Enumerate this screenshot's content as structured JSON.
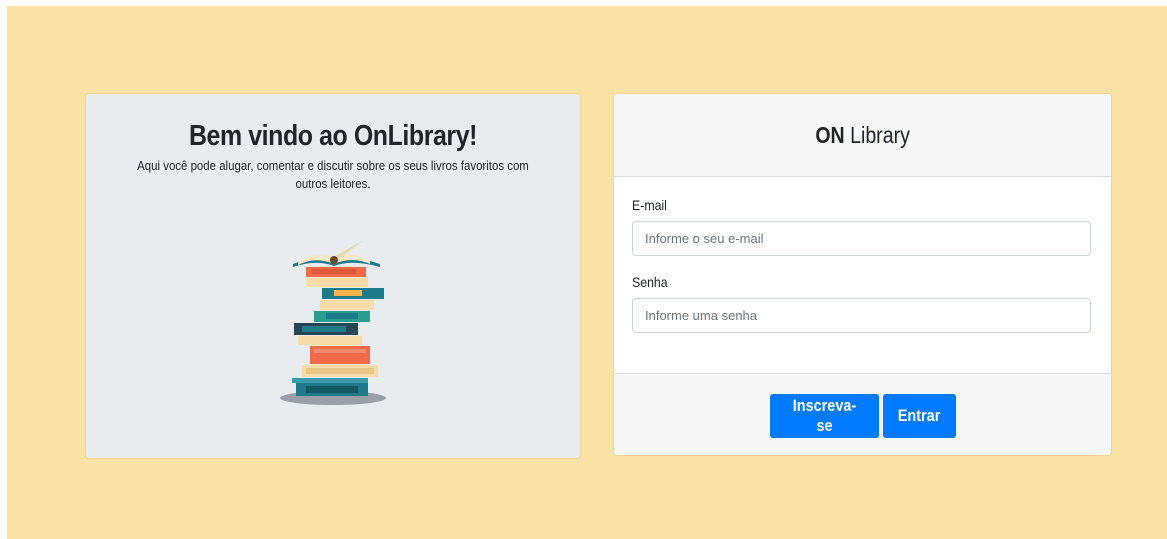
{
  "welcome": {
    "title": "Bem vindo ao OnLibrary!",
    "description": "Aqui você pode alugar, comentar e discutir sobre os seus livros favoritos com outros leitores."
  },
  "login": {
    "brand_bold": "ON",
    "brand_rest": " Library",
    "email_label": "E-mail",
    "email_placeholder": "Informe o seu e-mail",
    "password_label": "Senha",
    "password_placeholder": "Informe uma senha",
    "signup_label": "Inscreva-se",
    "login_label": "Entrar"
  },
  "colors": {
    "page_background": "#fae2a6",
    "card_background": "#e9ecef",
    "primary_button": "#007bff"
  },
  "icons": {
    "illustration": "books-stack-icon"
  }
}
